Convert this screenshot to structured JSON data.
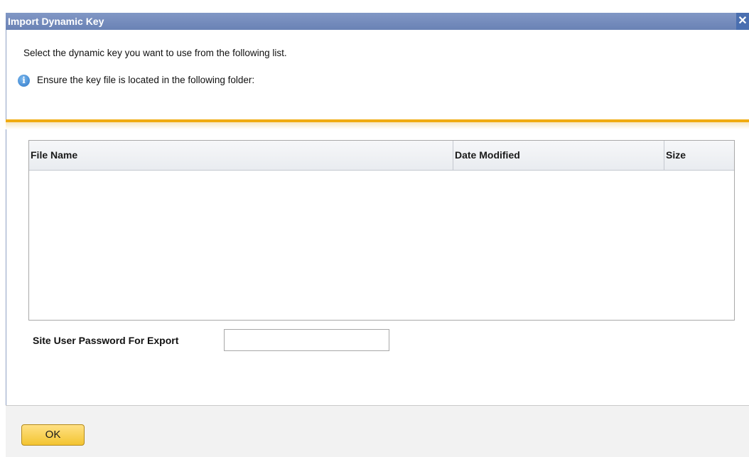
{
  "dialog": {
    "title": "Import Dynamic Key",
    "close_symbol": "✕",
    "instruction": "Select the dynamic key you want to use from the following list.",
    "info_icon": "info-icon",
    "info_text": "Ensure the key file is located in the following folder:"
  },
  "table": {
    "columns": [
      "File Name",
      "Date Modified",
      "Size"
    ],
    "rows": []
  },
  "password": {
    "label": "Site User Password For Export",
    "value": ""
  },
  "footer": {
    "ok_label": "OK"
  },
  "colors": {
    "title_bar": "#7189bb",
    "accent_orange": "#f0ab10",
    "ok_button": "#f3c431"
  }
}
